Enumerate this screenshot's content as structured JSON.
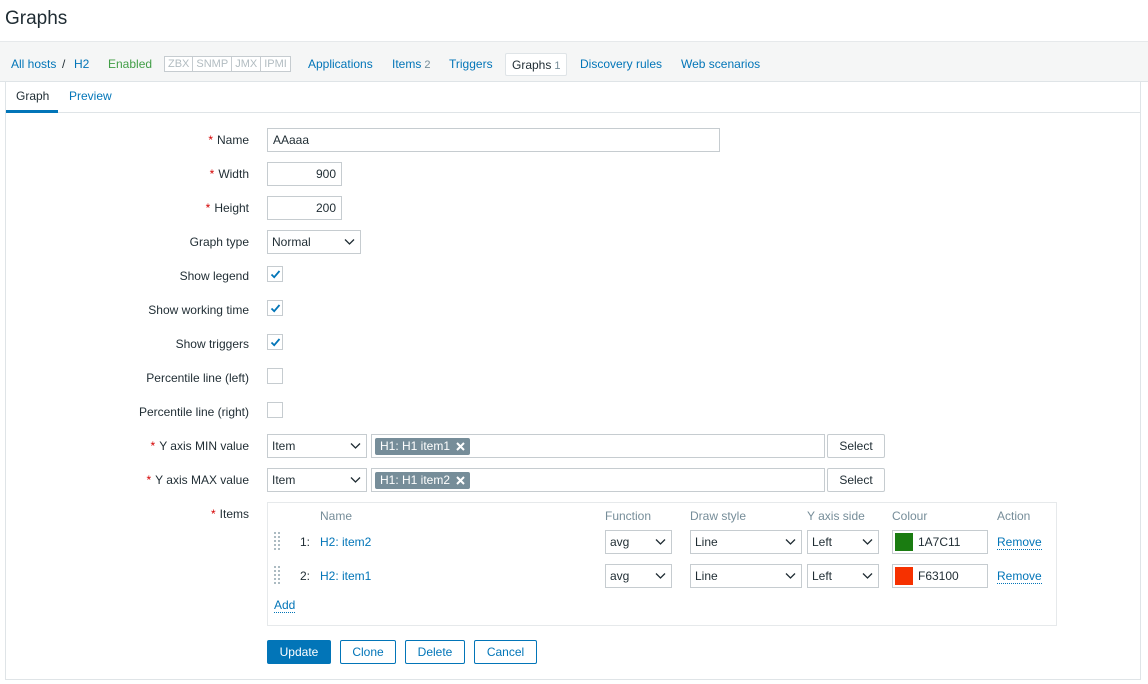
{
  "page": {
    "title": "Graphs"
  },
  "nav": {
    "all_hosts": "All hosts",
    "separator": "/",
    "host": "H2",
    "status": "Enabled",
    "availability": [
      "ZBX",
      "SNMP",
      "JMX",
      "IPMI"
    ],
    "applications": "Applications",
    "items": "Items",
    "items_count": "2",
    "triggers": "Triggers",
    "graphs": "Graphs",
    "graphs_count": "1",
    "discovery_rules": "Discovery rules",
    "web_scenarios": "Web scenarios"
  },
  "tabs": {
    "graph": "Graph",
    "preview": "Preview"
  },
  "form": {
    "name_label": "Name",
    "name_value": "AAaaa",
    "width_label": "Width",
    "width_value": "900",
    "height_label": "Height",
    "height_value": "200",
    "graph_type_label": "Graph type",
    "graph_type_value": "Normal",
    "show_legend_label": "Show legend",
    "show_legend": true,
    "show_working_time_label": "Show working time",
    "show_working_time": true,
    "show_triggers_label": "Show triggers",
    "show_triggers": true,
    "percentile_left_label": "Percentile line (left)",
    "percentile_left": false,
    "percentile_right_label": "Percentile line (right)",
    "percentile_right": false,
    "ymin_label": "Y axis MIN value",
    "ymin_type": "Item",
    "ymin_item": "H1: H1 item1",
    "ymax_label": "Y axis MAX value",
    "ymax_type": "Item",
    "ymax_item": "H1: H1 item2",
    "select_label": "Select",
    "items_label": "Items"
  },
  "items_table": {
    "headers": {
      "name": "Name",
      "function": "Function",
      "draw_style": "Draw style",
      "y_axis_side": "Y axis side",
      "colour": "Colour",
      "action": "Action"
    },
    "rows": [
      {
        "num": "1:",
        "name": "H2: item2",
        "function": "avg",
        "draw_style": "Line",
        "y_axis_side": "Left",
        "colour": "1A7C11",
        "colour_hex": "#1A7C11",
        "action": "Remove"
      },
      {
        "num": "2:",
        "name": "H2: item1",
        "function": "avg",
        "draw_style": "Line",
        "y_axis_side": "Left",
        "colour": "F63100",
        "colour_hex": "#F63100",
        "action": "Remove"
      }
    ],
    "add_label": "Add"
  },
  "buttons": {
    "update": "Update",
    "clone": "Clone",
    "delete": "Delete",
    "cancel": "Cancel"
  },
  "colors": {
    "link": "#0275b8",
    "enabled": "#429e47",
    "required": "#d40000"
  },
  "icons": {
    "checkbox_checked": "checkmark-icon",
    "tag_remove": "close-icon",
    "select_arrow": "chevron-down-icon",
    "drag": "drag-handle-icon"
  }
}
